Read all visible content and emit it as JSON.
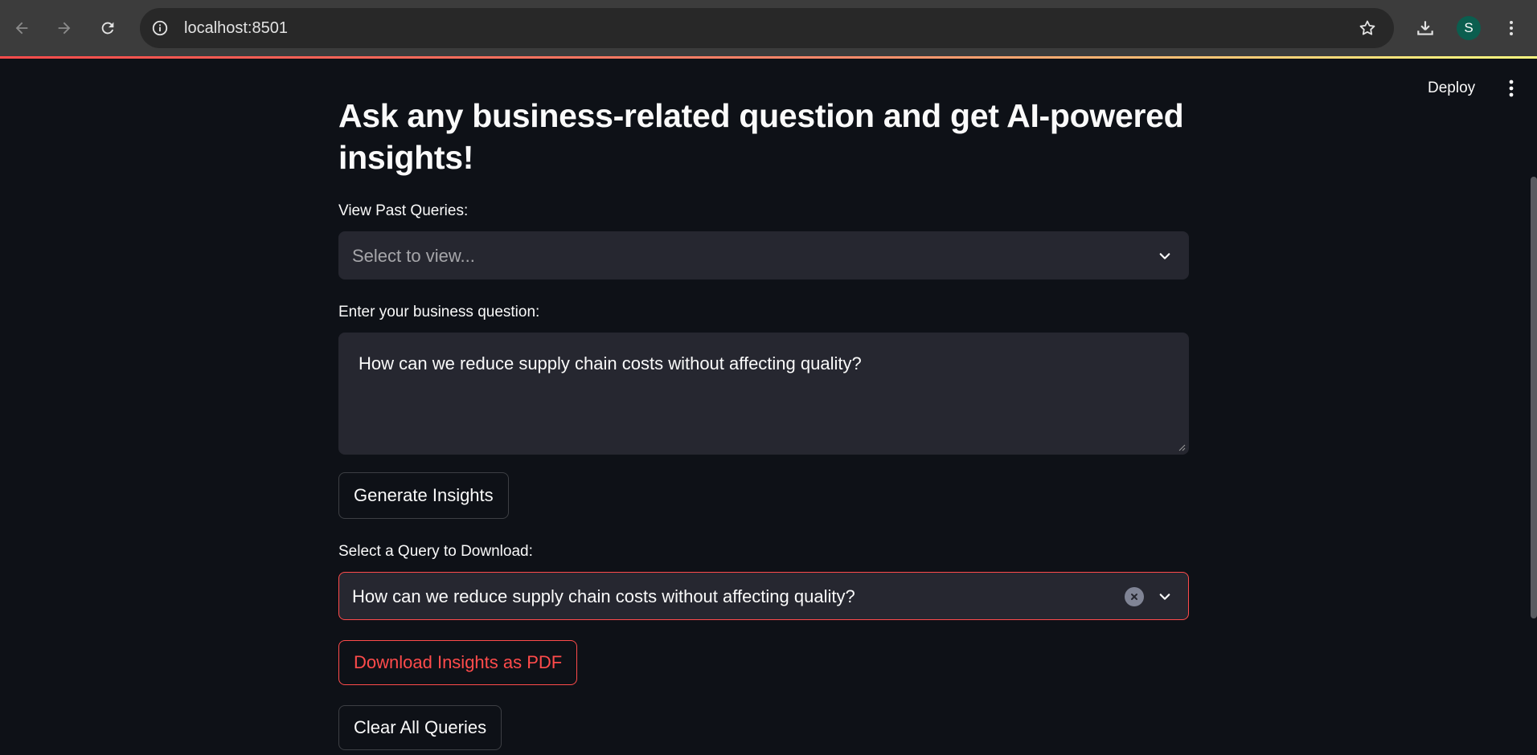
{
  "browser": {
    "url": "localhost:8501",
    "profile_initial": "S",
    "icons": {
      "back": "arrow-left-icon",
      "forward": "arrow-right-icon",
      "reload": "reload-icon",
      "site_info": "info-icon",
      "bookmark": "star-icon",
      "downloads": "download-icon",
      "menu": "kebab-menu-icon"
    }
  },
  "app_header": {
    "deploy_label": "Deploy",
    "menu_icon": "kebab-menu-icon"
  },
  "main": {
    "headline": "Ask any business-related question and get AI-powered insights!",
    "past_queries": {
      "label": "View Past Queries:",
      "placeholder": "Select to view..."
    },
    "question": {
      "label": "Enter your business question:",
      "value": "How can we reduce supply chain costs without affecting quality?"
    },
    "generate_button": "Generate Insights",
    "download_select": {
      "label": "Select a Query to Download:",
      "value": "How can we reduce supply chain costs without affecting quality?"
    },
    "download_button": "Download Insights as PDF",
    "clear_button": "Clear All Queries"
  },
  "colors": {
    "background": "#0e1117",
    "widget_bg": "#262730",
    "accent": "#ff4b4b",
    "text": "#fafafa",
    "chrome_bg": "#3c3c3c",
    "avatar_bg": "#0b5e4f"
  }
}
